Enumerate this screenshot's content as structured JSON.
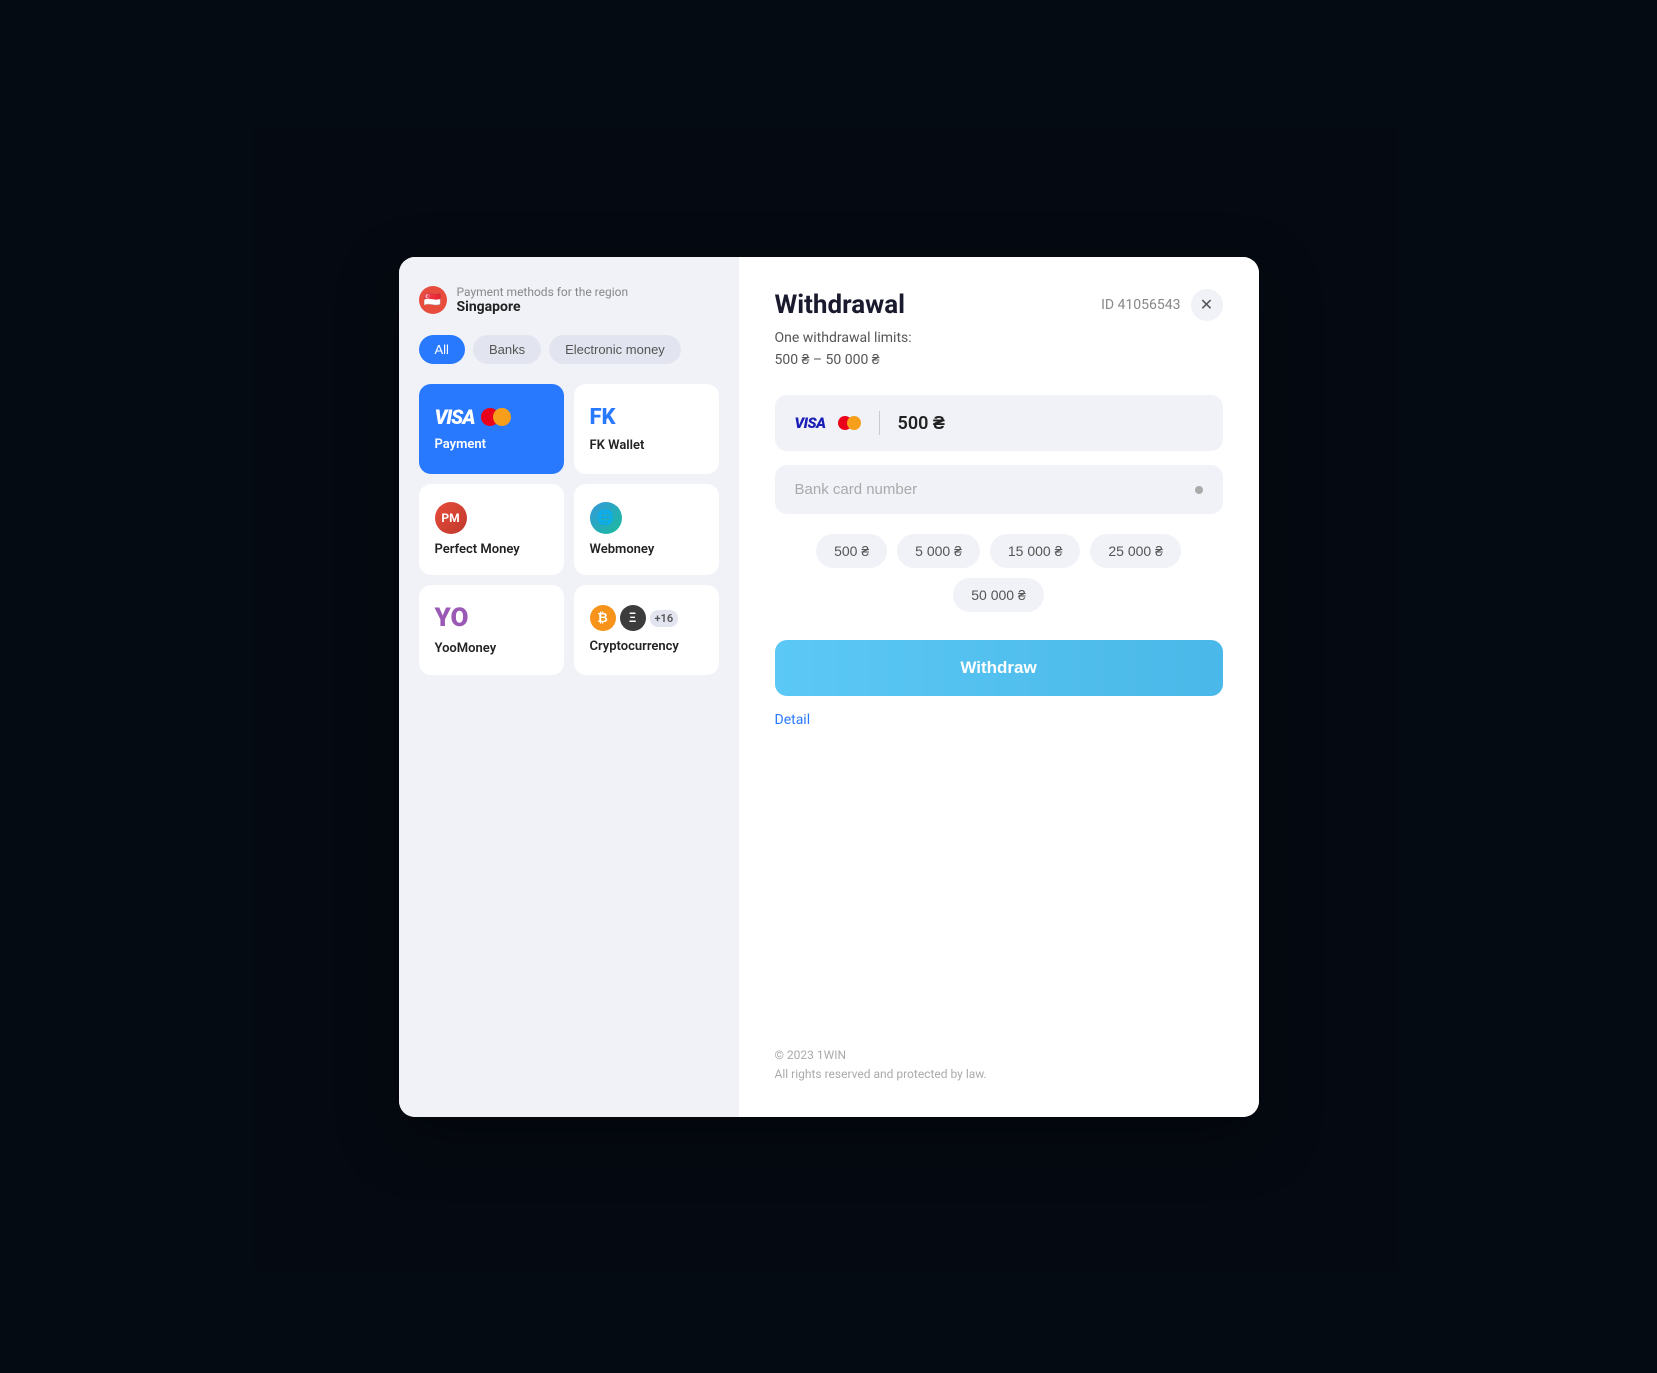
{
  "modal": {
    "region": {
      "label": "Payment methods for the region",
      "name": "Singapore"
    },
    "filters": {
      "active": "All",
      "items": [
        "All",
        "Banks",
        "Electronic money"
      ]
    },
    "payment_methods": [
      {
        "id": "visa",
        "label": "Payment",
        "type": "visa",
        "active": true
      },
      {
        "id": "fk-wallet",
        "label": "FK Wallet",
        "type": "fk",
        "active": false
      },
      {
        "id": "perfect-money",
        "label": "Perfect Money",
        "type": "pm",
        "active": false
      },
      {
        "id": "webmoney",
        "label": "Webmoney",
        "type": "wm",
        "active": false
      },
      {
        "id": "yoomoney",
        "label": "YooMoney",
        "type": "yoo",
        "active": false
      },
      {
        "id": "cryptocurrency",
        "label": "Cryptocurrency",
        "type": "crypto",
        "active": false
      }
    ],
    "right": {
      "title": "Withdrawal",
      "id_label": "ID 41056543",
      "limits_line1": "One withdrawal limits:",
      "limits_line2": "500 ₴ – 50 000 ₴",
      "amount_display": "500 ₴",
      "card_input_placeholder": "Bank card number",
      "quick_amounts": [
        "500 ₴",
        "5 000 ₴",
        "15 000 ₴",
        "25 000 ₴",
        "50 000 ₴"
      ],
      "withdraw_button": "Withdraw",
      "detail_link": "Detail",
      "footer_line1": "© 2023 1WIN",
      "footer_line2": "All rights reserved and protected by law.",
      "crypto_plus": "+16"
    }
  }
}
